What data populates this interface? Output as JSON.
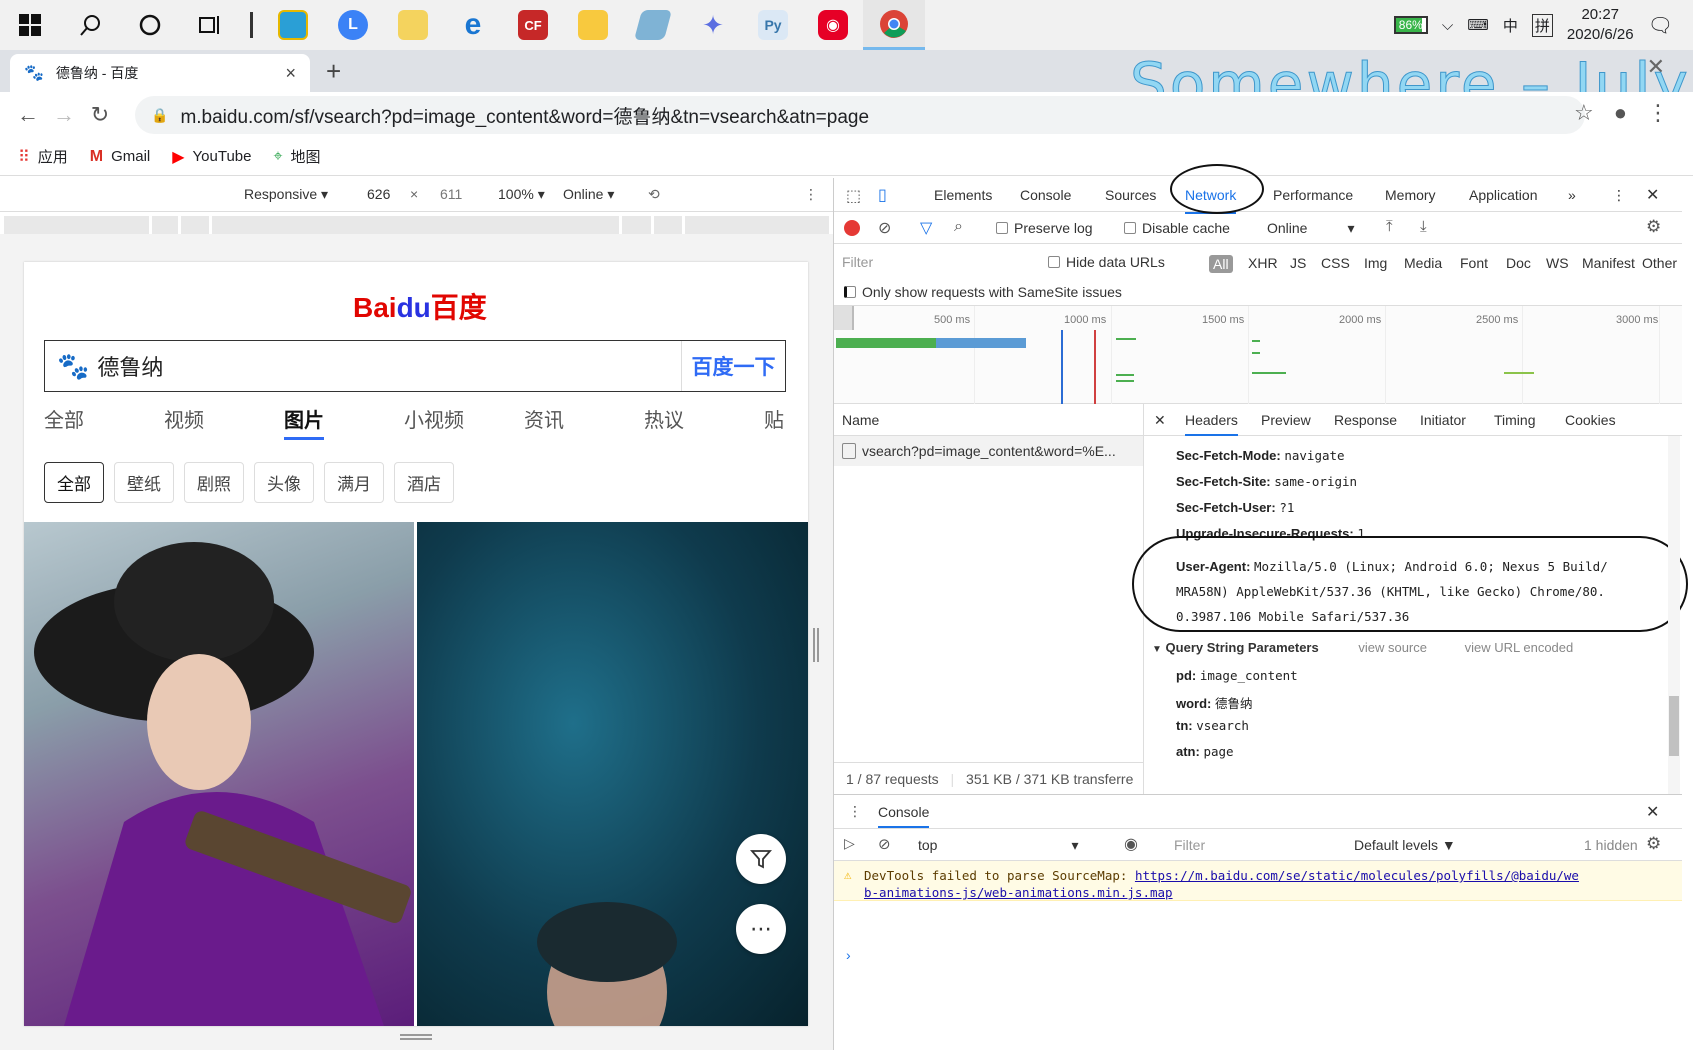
{
  "taskbar": {
    "battery": "86%",
    "ime1": "中",
    "ime2": "拼",
    "time": "20:27",
    "date": "2020/6/26"
  },
  "browser": {
    "tab_title": "德鲁纳 - 百度",
    "url": "m.baidu.com/sf/vsearch?pd=image_content&word=德鲁纳&tn=vsearch&atn=page",
    "overlay_text": "Somewhere – July",
    "bookmarks": [
      "应用",
      "Gmail",
      "YouTube",
      "地图"
    ]
  },
  "device_toolbar": {
    "mode": "Responsive",
    "width": "626",
    "height": "611",
    "zoom": "100%",
    "network": "Online"
  },
  "mobile": {
    "logo_left": "Bai",
    "logo_du": "du",
    "logo_right": "百度",
    "query": "德鲁纳",
    "search_button": "百度一下",
    "nav_tabs": [
      "全部",
      "视频",
      "图片",
      "小视频",
      "资讯",
      "热议",
      "贴"
    ],
    "chips": [
      "全部",
      "壁纸",
      "剧照",
      "头像",
      "满月",
      "酒店"
    ]
  },
  "devtools": {
    "tabs": [
      "Elements",
      "Console",
      "Sources",
      "Network",
      "Performance",
      "Memory",
      "Application"
    ],
    "preserve_log": "Preserve log",
    "disable_cache": "Disable cache",
    "throttle": "Online",
    "filter_placeholder": "Filter",
    "hide_data_urls": "Hide data URLs",
    "filter_types": [
      "All",
      "XHR",
      "JS",
      "CSS",
      "Img",
      "Media",
      "Font",
      "Doc",
      "WS",
      "Manifest",
      "Other"
    ],
    "samesite": "Only show requests with SameSite issues",
    "timeline_labels": [
      "500 ms",
      "1000 ms",
      "1500 ms",
      "2000 ms",
      "2500 ms",
      "3000 ms"
    ],
    "name_header": "Name",
    "request_name": "vsearch?pd=image_content&word=%E...",
    "footer_requests": "1 / 87 requests",
    "footer_transfer": "351 KB / 371 KB transferre",
    "detail_tabs": [
      "Headers",
      "Preview",
      "Response",
      "Initiator",
      "Timing",
      "Cookies"
    ],
    "headers": [
      {
        "k": "Sec-Fetch-Mode:",
        "v": "navigate"
      },
      {
        "k": "Sec-Fetch-Site:",
        "v": "same-origin"
      },
      {
        "k": "Sec-Fetch-User:",
        "v": "?1"
      },
      {
        "k": "Upgrade-Insecure-Requests:",
        "v": "1"
      }
    ],
    "user_agent_key": "User-Agent:",
    "user_agent_l1": "Mozilla/5.0 (Linux; Android 6.0; Nexus 5 Build/",
    "user_agent_l2": "MRA58N) AppleWebKit/537.36 (KHTML, like Gecko) Chrome/80.",
    "user_agent_l3": "0.3987.106 Mobile Safari/537.36",
    "qs_title": "Query String Parameters",
    "view_source": "view source",
    "view_url_encoded": "view URL encoded",
    "params": [
      {
        "k": "pd:",
        "v": "image_content"
      },
      {
        "k": "word:",
        "v": "德鲁纳"
      },
      {
        "k": "tn:",
        "v": "vsearch"
      },
      {
        "k": "atn:",
        "v": "page"
      }
    ],
    "console_tab": "Console",
    "console_context": "top",
    "console_filter": "Filter",
    "default_levels": "Default levels ▼",
    "hidden_count": "1 hidden",
    "warning_prefix": "DevTools failed to parse SourceMap: ",
    "warning_link_l1": "https://m.baidu.com/se/static/molecules/polyfills/@baidu/we",
    "warning_link_l2": "b-animations-js/web-animations.min.js.map"
  }
}
